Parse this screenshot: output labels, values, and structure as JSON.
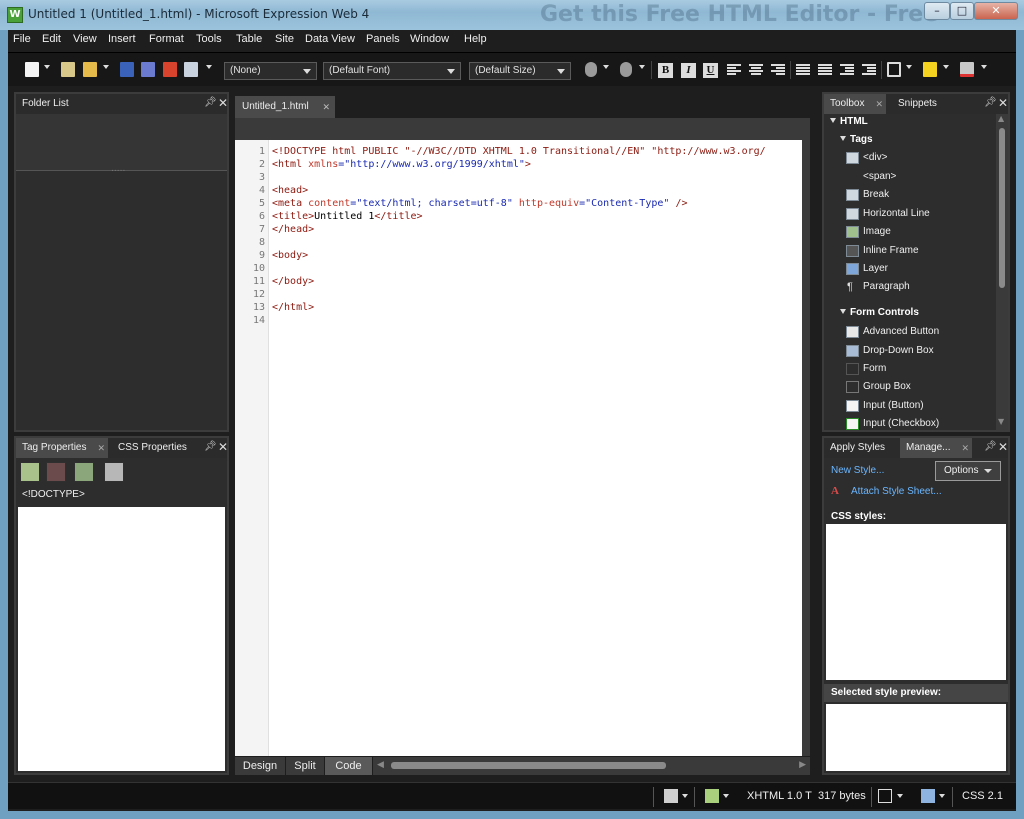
{
  "window": {
    "title": "Untitled 1 (Untitled_1.html) - Microsoft Expression Web 4",
    "promo": "Get this Free HTML Editor - Free",
    "min": "–",
    "max": "□",
    "close": "✕"
  },
  "menu": [
    "File",
    "Edit",
    "View",
    "Insert",
    "Format",
    "Tools",
    "Table",
    "Site",
    "Data View",
    "Panels",
    "Window",
    "Help"
  ],
  "toolbar": {
    "style_combo": "(None)",
    "font_combo": "(Default Font)",
    "size_combo": "(Default Size)",
    "bold": "B",
    "italic": "I",
    "underline": "U"
  },
  "folder_list": {
    "title": "Folder List",
    "grip": "....."
  },
  "tag_panel": {
    "tab1": "Tag Properties",
    "tab2": "CSS Properties",
    "current_tag": "<!DOCTYPE>"
  },
  "document": {
    "tab": "Untitled_1.html",
    "line_numbers": [
      "1",
      "2",
      "3",
      "4",
      "5",
      "6",
      "7",
      "8",
      "9",
      "10",
      "11",
      "12",
      "13",
      "14"
    ],
    "view_tabs": [
      "Design",
      "Split",
      "Code"
    ]
  },
  "code": {
    "l1a": "<!DOCTYPE html PUBLIC ",
    "l1b": "\"-//W3C//DTD XHTML 1.0 Transitional//EN\" \"http://www.w3.org/",
    "l2a": "<html ",
    "l2b": "xmlns",
    "l2c": "=",
    "l2d": "\"http://www.w3.org/1999/xhtml\"",
    "l2e": ">",
    "l4": "<head>",
    "l5a": "<meta ",
    "l5b": "content",
    "l5c": "=",
    "l5d": "\"text/html; charset=utf-8\"",
    "l5e": " http-equiv",
    "l5f": "=",
    "l5g": "\"Content-Type\"",
    "l5h": " />",
    "l6a": "<title>",
    "l6b": "Untitled 1",
    "l6c": "</title>",
    "l7": "</head>",
    "l9": "<body>",
    "l11": "</body>",
    "l13": "</html>"
  },
  "toolbox": {
    "tab1": "Toolbox",
    "tab2": "Snippets",
    "section": "HTML",
    "tags_head": "Tags",
    "tags": [
      "<div>",
      "<span>",
      "Break",
      "Horizontal Line",
      "Image",
      "Inline Frame",
      "Layer",
      "Paragraph"
    ],
    "forms_head": "Form Controls",
    "forms": [
      "Advanced Button",
      "Drop-Down Box",
      "Form",
      "Group Box",
      "Input (Button)",
      "Input (Checkbox)"
    ]
  },
  "styles": {
    "tab1": "Apply Styles",
    "tab2": "Manage...",
    "new_style": "New Style...",
    "options": "Options",
    "attach": "Attach Style Sheet...",
    "css_label": "CSS styles:",
    "preview_label": "Selected style preview:"
  },
  "status": {
    "doctype": "XHTML 1.0 T",
    "size": "317 bytes",
    "css": "CSS 2.1"
  }
}
